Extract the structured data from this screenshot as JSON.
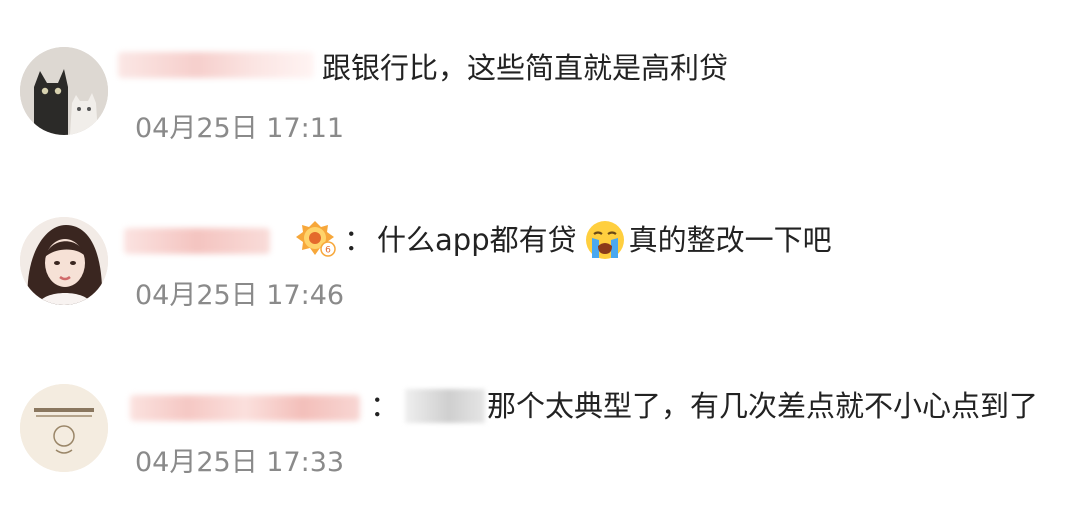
{
  "comments": [
    {
      "avatar": "cats-avatar",
      "separator": "",
      "text": "跟银行比，这些简直就是高利贷",
      "timestamp": "04月25日 17:11"
    },
    {
      "avatar": "girl-avatar",
      "separator": "：",
      "text_part1": "什么app都有贷",
      "emoji": "crying-face-icon",
      "text_part2": " 真的整改一下吧",
      "timestamp": "04月25日 17:46"
    },
    {
      "avatar": "seal-avatar",
      "separator": "：",
      "text": "那个太典型了，有几次差点就不小心点到了",
      "timestamp": "04月25日 17:33"
    }
  ],
  "colors": {
    "text": "#222222",
    "timestamp": "#8a8a8a",
    "redaction": "#f6c9c6"
  }
}
